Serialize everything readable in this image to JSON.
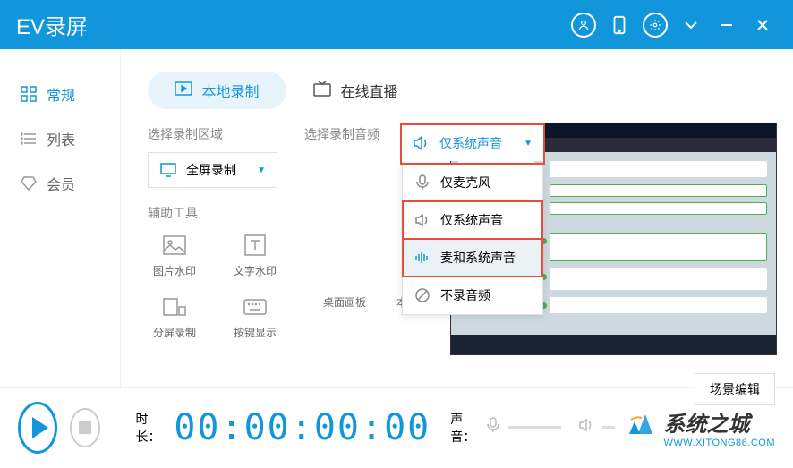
{
  "app": {
    "title": "EV录屏"
  },
  "sidebar": {
    "items": [
      {
        "label": "常规"
      },
      {
        "label": "列表"
      },
      {
        "label": "会员"
      }
    ]
  },
  "tabs": {
    "local": "本地录制",
    "online": "在线直播"
  },
  "area": {
    "label": "选择录制区域",
    "selected": "全屏录制"
  },
  "audio": {
    "label": "选择录制音频",
    "selected": "仅系统声音",
    "options": [
      {
        "label": "仅麦克风"
      },
      {
        "label": "仅系统声音"
      },
      {
        "label": "麦和系统声音"
      },
      {
        "label": "不录音频"
      }
    ]
  },
  "tools": {
    "label": "辅助工具",
    "items": [
      {
        "label": "图片水印"
      },
      {
        "label": "文字水印"
      },
      {
        "label": "分屏录制"
      },
      {
        "label": "按键显示"
      },
      {
        "label": "桌面画板"
      },
      {
        "label": "本地直播"
      }
    ]
  },
  "scene_btn": "场景编辑",
  "footer": {
    "duration_label": "时长：",
    "timer": "00:00:00:00",
    "volume_label": "声音："
  },
  "brand": {
    "cn": "系统之城",
    "en": "WWW.XITONG86.COM"
  }
}
